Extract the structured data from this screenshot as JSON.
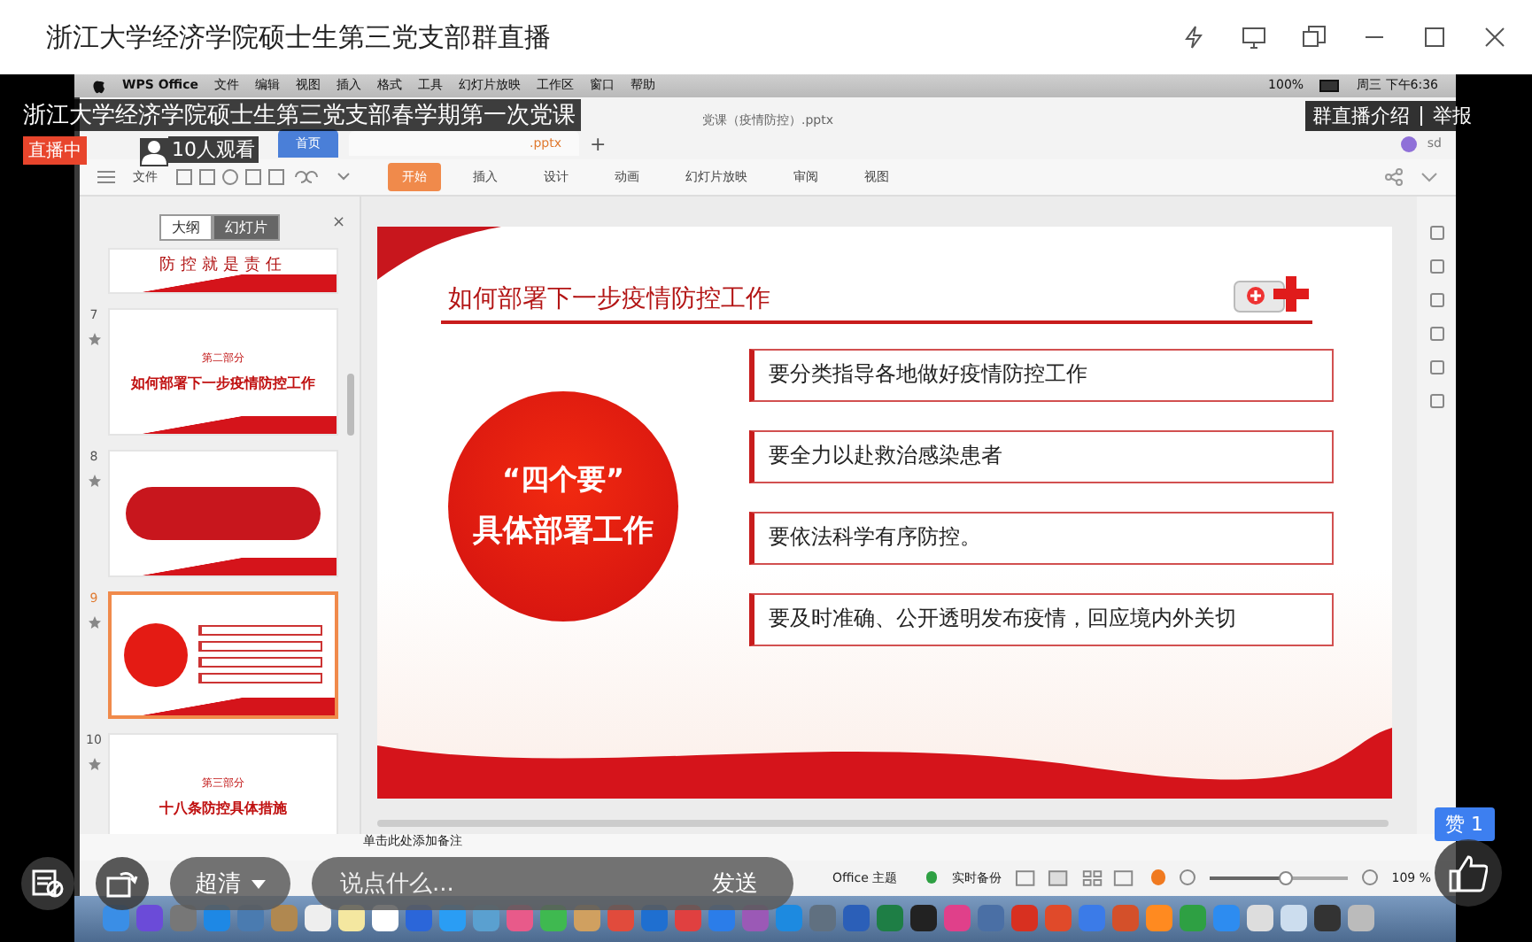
{
  "window": {
    "title": "浙江大学经济学院硕士生第三党支部群直播"
  },
  "stream": {
    "title": "浙江大学经济学院硕士生第三党支部春学期第一次党课",
    "status_badge": "直播中",
    "viewers": "10人观看",
    "links": [
      "群直播介绍",
      "举报"
    ],
    "quality": "超清",
    "comment_placeholder": "说点什么...",
    "send": "发送",
    "likes": "赞 1"
  },
  "menubar": {
    "app": "WPS Office",
    "items": [
      "文件",
      "编辑",
      "视图",
      "插入",
      "格式",
      "工具",
      "幻灯片放映",
      "工作区",
      "窗口",
      "帮助"
    ],
    "battery": "100%",
    "clock": "周三 下午6:36"
  },
  "wps": {
    "doc_title": "党课（疫情防控）.pptx",
    "tabs": [
      {
        "label": "首页",
        "selected": false
      },
      {
        "label": ".pptx",
        "selected": true
      }
    ],
    "user": "sd",
    "file_menu": "文件",
    "new_tab": "+",
    "ribbon_tabs": [
      {
        "label": "开始",
        "selected": true
      },
      {
        "label": "插入",
        "selected": false
      },
      {
        "label": "设计",
        "selected": false
      },
      {
        "label": "动画",
        "selected": false
      },
      {
        "label": "幻灯片放映",
        "selected": false
      },
      {
        "label": "审阅",
        "selected": false
      },
      {
        "label": "视图",
        "selected": false
      }
    ]
  },
  "panel": {
    "views": [
      {
        "label": "大纲",
        "selected": false
      },
      {
        "label": "幻灯片",
        "selected": true
      }
    ],
    "close": "×",
    "slides": [
      {
        "kind": "banner",
        "selected": false,
        "lines": [
          "防控就是责任"
        ]
      },
      {
        "kind": "section",
        "number": "7",
        "selected": false,
        "lines": [
          "第二部分",
          "如何部署下一步疫情防控工作"
        ]
      },
      {
        "kind": "box",
        "number": "8",
        "selected": false
      },
      {
        "kind": "list",
        "number": "9",
        "selected": true
      },
      {
        "kind": "section",
        "number": "10",
        "selected": false,
        "lines": [
          "第三部分",
          "十八条防控具体措施"
        ]
      }
    ]
  },
  "slide": {
    "title": "如何部署下一步疫情防控工作",
    "circle_lines": [
      "“四个要”",
      "具体部署工作"
    ],
    "points": [
      "要分类指导各地做好疫情防控工作",
      "要全力以赴救治感染患者",
      "要依法科学有序防控。",
      "要及时准确、公开透明发布疫情，回应境内外关切"
    ]
  },
  "notes_placeholder": "单击此处添加备注",
  "status_bar": {
    "theme": "Office 主题",
    "backup": "实时备份",
    "zoom": "109 %",
    "zoom_slider": {
      "level": 0.55
    }
  }
}
